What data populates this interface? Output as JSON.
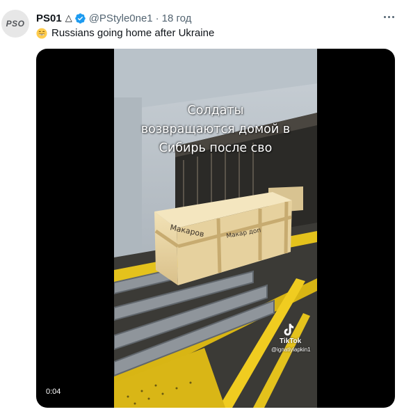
{
  "tweet": {
    "avatar_text": "PSO",
    "display_name": "PS01",
    "name_symbol": "△",
    "handle": "@PStyle0ne1",
    "separator": "·",
    "timestamp": "18 год",
    "emoji": "😄",
    "text": "Russians going home after Ukraine",
    "verified_color": "#1d9bf0"
  },
  "media": {
    "overlay_lines": [
      "Солдаты",
      "возвращаются домой в",
      "Сибирь после сво"
    ],
    "crate_label_1": "Макаров",
    "crate_label_2": "Макар доп",
    "watermark_brand": "TikTok",
    "watermark_user": "@ignatiylapkin1",
    "duration": "0:04"
  }
}
